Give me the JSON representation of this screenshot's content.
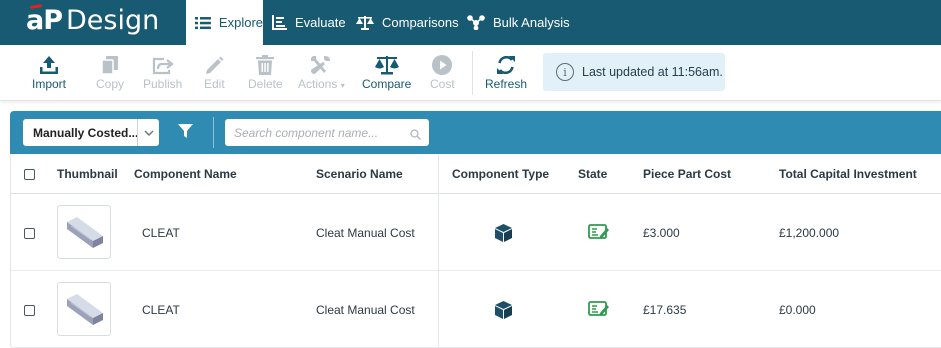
{
  "app": {
    "brand": "aP",
    "product": "Design"
  },
  "nav": {
    "tabs": [
      {
        "label": "Explore",
        "icon": "list-icon",
        "active": true
      },
      {
        "label": "Evaluate",
        "icon": "chart-icon",
        "active": false
      },
      {
        "label": "Comparisons",
        "icon": "scale-icon",
        "active": false
      },
      {
        "label": "Bulk Analysis",
        "icon": "molecule-icon",
        "active": false
      }
    ]
  },
  "toolbar": {
    "buttons": [
      {
        "label": "Import",
        "icon": "upload-icon",
        "enabled": true
      },
      {
        "label": "Copy",
        "icon": "copy-icon",
        "enabled": false
      },
      {
        "label": "Publish",
        "icon": "share-icon",
        "enabled": false
      },
      {
        "label": "Edit",
        "icon": "pencil-icon",
        "enabled": false
      },
      {
        "label": "Delete",
        "icon": "trash-icon",
        "enabled": false
      },
      {
        "label": "Actions",
        "icon": "tools-icon",
        "enabled": false
      },
      {
        "label": "Compare",
        "icon": "scale-icon",
        "enabled": true
      },
      {
        "label": "Cost",
        "icon": "play-icon",
        "enabled": false
      },
      {
        "label": "Refresh",
        "icon": "refresh-icon",
        "enabled": true
      }
    ],
    "info_text": "Last updated at 11:56am."
  },
  "filter": {
    "selected_view": "Manually Costed...",
    "search_placeholder": "Search component name..."
  },
  "table": {
    "columns": [
      "Thumbnail",
      "Component Name",
      "Scenario Name",
      "Component Type",
      "State",
      "Piece Part Cost",
      "Total Capital Investment"
    ],
    "rows": [
      {
        "component_name": "CLEAT",
        "scenario_name": "Cleat Manual Cost",
        "component_type_icon": "cube-icon",
        "state_icon": "manual-cost-icon",
        "piece_part_cost": "£3.000",
        "total_capital_investment": "£1,200.000"
      },
      {
        "component_name": "CLEAT",
        "scenario_name": "Cleat Manual Cost",
        "component_type_icon": "cube-icon",
        "state_icon": "manual-cost-icon",
        "piece_part_cost": "£17.635",
        "total_capital_investment": "£0.000"
      }
    ]
  },
  "colors": {
    "nav_bg": "#185a72",
    "filter_bar": "#2f8bb1",
    "accent": "#185a72",
    "state_green": "#2e9d4e",
    "disabled": "#b9c2c8"
  }
}
